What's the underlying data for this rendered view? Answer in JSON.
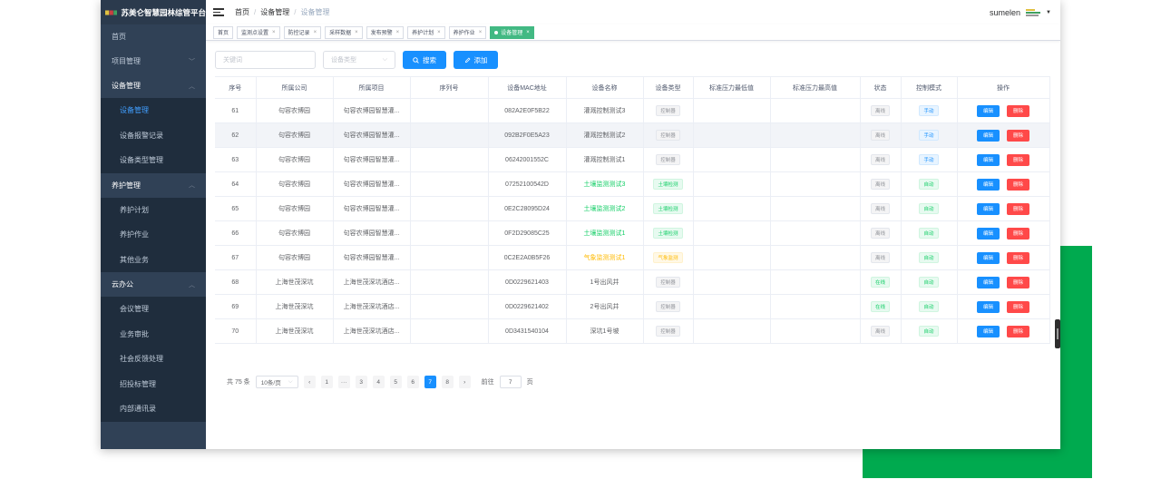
{
  "brand": {
    "logo_colors": [
      "#e0c040",
      "#c84040",
      "#40a060"
    ],
    "title": "苏美仑智慧园林综管平台"
  },
  "sidebar": {
    "items": [
      {
        "label": "首页",
        "type": "top"
      },
      {
        "label": "项目管理",
        "type": "group",
        "chevron": "down"
      },
      {
        "label": "设备管理",
        "type": "group",
        "chevron": "up",
        "open": true
      },
      {
        "label": "设备管理",
        "type": "sub",
        "active": true
      },
      {
        "label": "设备报警记录",
        "type": "sub"
      },
      {
        "label": "设备类型管理",
        "type": "sub"
      },
      {
        "label": "养护管理",
        "type": "group",
        "chevron": "up",
        "open": true
      },
      {
        "label": "养护计划",
        "type": "sub"
      },
      {
        "label": "养护作业",
        "type": "sub"
      },
      {
        "label": "其他业务",
        "type": "sub"
      },
      {
        "label": "云办公",
        "type": "group",
        "chevron": "up",
        "open": true
      },
      {
        "label": "会议管理",
        "type": "sub"
      },
      {
        "label": "业务审批",
        "type": "sub"
      },
      {
        "label": "社会反馈处理",
        "type": "sub"
      },
      {
        "label": "招投标管理",
        "type": "sub"
      },
      {
        "label": "内部通讯录",
        "type": "sub"
      }
    ]
  },
  "navbar": {
    "breadcrumb": [
      "首页",
      "设备管理",
      "设备管理"
    ],
    "username": "sumelen"
  },
  "tags": [
    {
      "label": "首页",
      "closable": false
    },
    {
      "label": "监测点设置",
      "closable": true
    },
    {
      "label": "防控记录",
      "closable": true
    },
    {
      "label": "采样数据",
      "closable": true
    },
    {
      "label": "发布预警",
      "closable": true
    },
    {
      "label": "养护计划",
      "closable": true
    },
    {
      "label": "养护作业",
      "closable": true
    },
    {
      "label": "设备管理",
      "closable": true,
      "active": true
    }
  ],
  "search": {
    "keyword_placeholder": "关键词",
    "type_placeholder": "设备类型",
    "search_label": "搜索",
    "add_label": "添加"
  },
  "table": {
    "columns": [
      "序号",
      "所属公司",
      "所属项目",
      "序列号",
      "设备MAC地址",
      "设备名称",
      "设备类型",
      "标准压力最低值",
      "标准压力最高值",
      "状态",
      "控制模式",
      "操作"
    ],
    "edit_label": "编辑",
    "delete_label": "删除",
    "rows": [
      {
        "no": "61",
        "company": "句容农博园",
        "project": "句容农博园智慧灌...",
        "serial": "",
        "mac": "082A2E0F5B22",
        "name": "灌溉控制测试3",
        "name_color": "normal",
        "type": "控制器",
        "type_style": "gray",
        "min": "",
        "max": "",
        "status": "离线",
        "status_style": "gray",
        "mode": "手动",
        "mode_style": "blue"
      },
      {
        "no": "62",
        "company": "句容农博园",
        "project": "句容农博园智慧灌...",
        "serial": "",
        "mac": "092B2F0E5A23",
        "name": "灌溉控制测试2",
        "name_color": "normal",
        "type": "控制器",
        "type_style": "gray",
        "min": "",
        "max": "",
        "status": "离线",
        "status_style": "gray",
        "mode": "手动",
        "mode_style": "blue"
      },
      {
        "no": "63",
        "company": "句容农博园",
        "project": "句容农博园智慧灌...",
        "serial": "",
        "mac": "06242001552C",
        "name": "灌溉控制测试1",
        "name_color": "normal",
        "type": "控制器",
        "type_style": "gray",
        "min": "",
        "max": "",
        "status": "离线",
        "status_style": "gray",
        "mode": "手动",
        "mode_style": "blue"
      },
      {
        "no": "64",
        "company": "句容农博园",
        "project": "句容农博园智慧灌...",
        "serial": "",
        "mac": "07252100542D",
        "name": "土壤监测测试3",
        "name_color": "green",
        "type": "土壤检测",
        "type_style": "green",
        "min": "",
        "max": "",
        "status": "离线",
        "status_style": "gray",
        "mode": "自动",
        "mode_style": "green"
      },
      {
        "no": "65",
        "company": "句容农博园",
        "project": "句容农博园智慧灌...",
        "serial": "",
        "mac": "0E2C28095D24",
        "name": "土壤监测测试2",
        "name_color": "green",
        "type": "土壤检测",
        "type_style": "green",
        "min": "",
        "max": "",
        "status": "离线",
        "status_style": "gray",
        "mode": "自动",
        "mode_style": "green"
      },
      {
        "no": "66",
        "company": "句容农博园",
        "project": "句容农博园智慧灌...",
        "serial": "",
        "mac": "0F2D29085C25",
        "name": "土壤监测测试1",
        "name_color": "green",
        "type": "土壤检测",
        "type_style": "green",
        "min": "",
        "max": "",
        "status": "离线",
        "status_style": "gray",
        "mode": "自动",
        "mode_style": "green"
      },
      {
        "no": "67",
        "company": "句容农博园",
        "project": "句容农博园智慧灌...",
        "serial": "",
        "mac": "0C2E2A0B5F26",
        "name": "气象监测测试1",
        "name_color": "orange",
        "type": "气象监测",
        "type_style": "orange",
        "min": "",
        "max": "",
        "status": "离线",
        "status_style": "gray",
        "mode": "自动",
        "mode_style": "green"
      },
      {
        "no": "68",
        "company": "上海世茂深坑",
        "project": "上海世茂深坑酒店...",
        "serial": "",
        "mac": "0D0229621403",
        "name": "1号出风井",
        "name_color": "normal",
        "type": "控制器",
        "type_style": "gray",
        "min": "",
        "max": "",
        "status": "在线",
        "status_style": "green",
        "mode": "自动",
        "mode_style": "green"
      },
      {
        "no": "69",
        "company": "上海世茂深坑",
        "project": "上海世茂深坑酒店...",
        "serial": "",
        "mac": "0D0229621402",
        "name": "2号出风井",
        "name_color": "normal",
        "type": "控制器",
        "type_style": "gray",
        "min": "",
        "max": "",
        "status": "在线",
        "status_style": "green",
        "mode": "自动",
        "mode_style": "green"
      },
      {
        "no": "70",
        "company": "上海世茂深坑",
        "project": "上海世茂深坑酒店...",
        "serial": "",
        "mac": "0D3431540104",
        "name": "深坑1号坡",
        "name_color": "normal",
        "type": "控制器",
        "type_style": "gray",
        "min": "",
        "max": "",
        "status": "离线",
        "status_style": "gray",
        "mode": "自动",
        "mode_style": "green"
      }
    ]
  },
  "pagination": {
    "total": "共 75 条",
    "page_size": "10条/页",
    "pages": [
      "1",
      "···",
      "3",
      "4",
      "5",
      "6",
      "7",
      "8"
    ],
    "current": "7",
    "jump_prefix": "前往",
    "jump_value": "7",
    "jump_suffix": "页"
  },
  "colors": {
    "sidebar_bg": "#304156",
    "accent": "#1890ff",
    "active_tag": "#42b983",
    "danger": "#ff4949",
    "green_block": "#00aa4f"
  }
}
